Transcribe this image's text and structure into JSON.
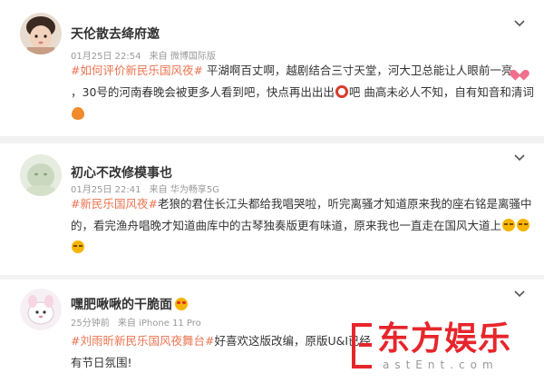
{
  "posts": [
    {
      "username": "天伦散去绛府邀",
      "time": "01月25日 22:54",
      "source": "来自 微博国际版",
      "content": {
        "tag": "#如何评价新民乐国风夜#",
        "text1": " 平湖啊百丈啊，越剧结合三寸天堂，河大卫总能让人眼前一亮",
        "text2": "，30号的河南春晚会被更多人看到吧，快点再出出出",
        "text3": "吧 曲高未必人不知，自有知音和清词"
      }
    },
    {
      "username": "初心不改修模事也",
      "time": "01月25日 22:41",
      "source": "来自 华为畅享5G",
      "content": {
        "tag": "#新民乐国风夜#",
        "text1": "老狼的君住长江头都给我唱哭啦，听完离骚才知道原来我的座右铭是离骚中的，看完渔舟唱晚才知道曲库中的古琴独奏版更有味道，原来我也一直走在国风大道上"
      }
    },
    {
      "username": "嘿肥啾啾的干脆面",
      "time": "25分钟前",
      "source": "来自 iPhone 11 Pro",
      "content": {
        "tag": "#刘雨昕新民乐国风夜舞台#",
        "text1": "好喜欢这版改编，原版U&I已经",
        "text2": "有节日氛围!"
      }
    }
  ],
  "watermark": {
    "title": "东方娱乐",
    "subtitle": "astEnt.com"
  }
}
